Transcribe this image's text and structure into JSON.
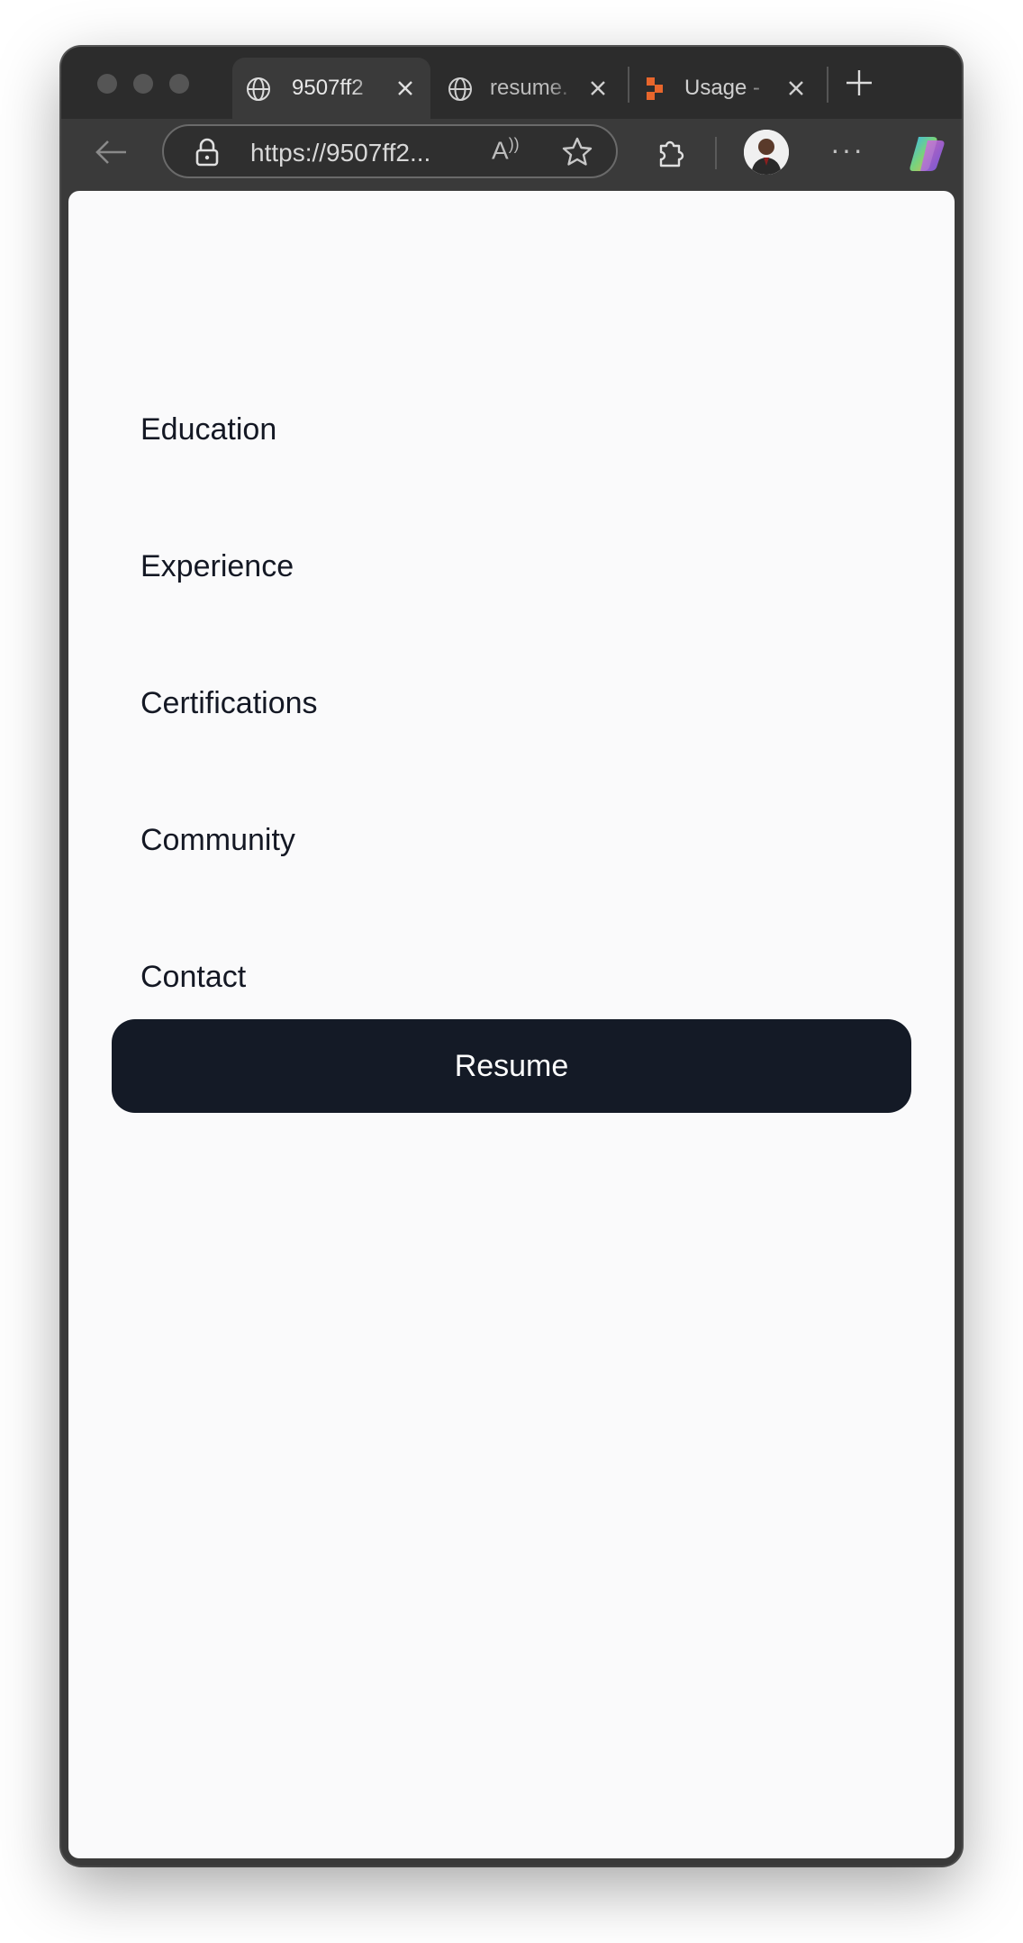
{
  "browser": {
    "tabs": [
      {
        "title": "9507ff2",
        "icon": "globe-icon",
        "active": true
      },
      {
        "title": "resume.",
        "icon": "globe-icon",
        "active": false
      },
      {
        "title": "Usage -",
        "icon": "app-logo-icon",
        "active": false
      }
    ],
    "url": "https://9507ff2...",
    "colors": {
      "accent": "#141a26",
      "tab_logo": "#e8662c"
    }
  },
  "nav": {
    "items": [
      {
        "label": "Education"
      },
      {
        "label": "Experience"
      },
      {
        "label": "Certifications"
      },
      {
        "label": "Community"
      },
      {
        "label": "Contact"
      }
    ],
    "resume_label": "Resume"
  }
}
